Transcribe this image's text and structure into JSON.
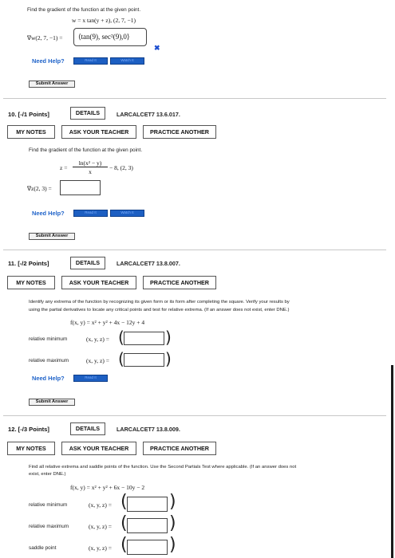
{
  "q9": {
    "instruction": "Find the gradient of the function at the given point.",
    "function": "w = x tan(y + z),  (2, 7, −1)",
    "grad_label": "∇w(2, 7, −1) =",
    "answer": "⟨tan(9), sec²(9),0⟩",
    "wrong_mark": "✖",
    "need_help": "Need Help?",
    "help_buttons": [
      "Read It",
      "Watch It"
    ],
    "submit": "Submit Answer"
  },
  "q10": {
    "header": "10.  [-/1 Points]",
    "details": "DETAILS",
    "code": "LARCALCET7 13.6.017.",
    "my_notes": "MY NOTES",
    "ask": "ASK YOUR TEACHER",
    "practice": "PRACTICE ANOTHER",
    "instruction": "Find the gradient of the function at the given point.",
    "z_eq": "z =",
    "numerator": "ln(x² − y)",
    "denominator": "x",
    "suffix": "− 8,     (2, 3)",
    "grad_label": "∇z(2, 3) =",
    "need_help": "Need Help?",
    "help_buttons": [
      "Read It",
      "Watch It"
    ],
    "submit": "Submit Answer"
  },
  "q11": {
    "header": "11.  [-/2 Points]",
    "details": "DETAILS",
    "code": "LARCALCET7 13.8.007.",
    "my_notes": "MY NOTES",
    "ask": "ASK YOUR TEACHER",
    "practice": "PRACTICE ANOTHER",
    "instruction_1": "Identify any extrema of the function by recognizing its given form or its form after completing the square. Verify your results by",
    "instruction_2": "using the partial derivatives to locate any critical points and test for relative extrema. (If an answer does not exist, enter DNE.)",
    "function": "f(x, y) = x² + y² + 4x − 12y + 4",
    "rel_min": "relative minimum",
    "rel_max": "relative maximum",
    "xyz": "(x, y, z) =",
    "need_help": "Need Help?",
    "help_buttons": [
      "Read It"
    ],
    "submit": "Submit Answer"
  },
  "q12": {
    "header": "12.  [-/3 Points]",
    "details": "DETAILS",
    "code": "LARCALCET7 13.8.009.",
    "my_notes": "MY NOTES",
    "ask": "ASK YOUR TEACHER",
    "practice": "PRACTICE ANOTHER",
    "instruction_1": "Find all relative extrema and saddle points of the function. Use the Second Partials Test where applicable. (If an answer does not",
    "instruction_2": "exist, enter DNE.)",
    "function": "f(x, y) = x² + y² + 6x − 10y − 2",
    "rel_min": "relative minimum",
    "rel_max": "relative maximum",
    "saddle": "saddle point",
    "xyz": "(x, y, z) ="
  },
  "colors": {
    "link_blue": "#1f63c9",
    "button_blue": "#1d5fc2",
    "error_blue": "#1e4fd0"
  }
}
